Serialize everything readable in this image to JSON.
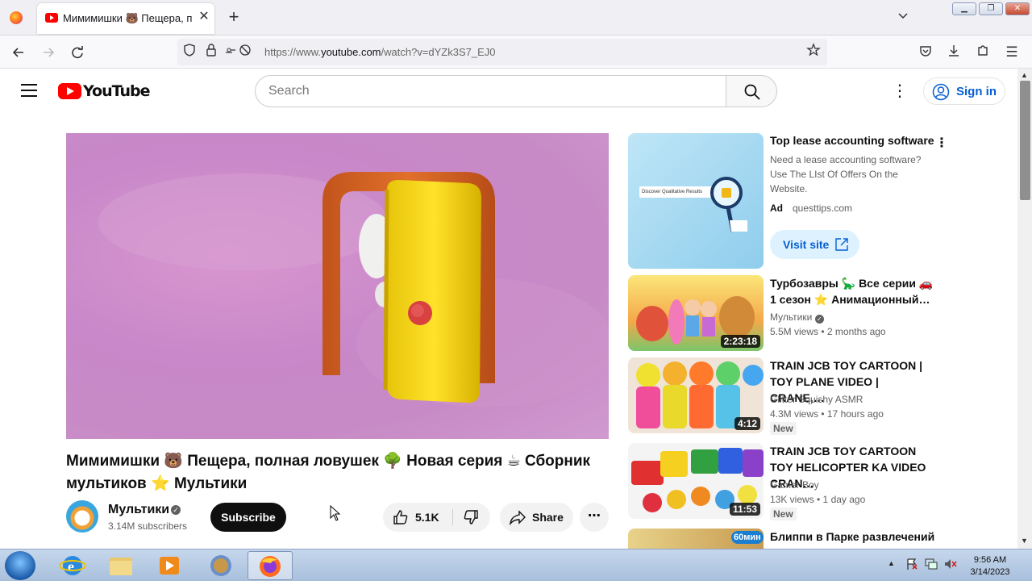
{
  "browser": {
    "tab_title": "Мимимишки 🐻 Пещера, полн",
    "url_prefix": "https://www.",
    "url_domain": "youtube.com",
    "url_path": "/watch?v=dYZk3S7_EJ0"
  },
  "header": {
    "logo_text": "YouTube",
    "search_placeholder": "Search",
    "signin_label": "Sign in"
  },
  "video": {
    "title": "Мимимишки 🐻 Пещера, полная ловушек 🌳 Новая серия ☕ Сборник мультиков ⭐ Мультики",
    "channel": "Мультики",
    "subscribers": "3.14M subscribers",
    "subscribe_label": "Subscribe",
    "likes": "5.1K",
    "share_label": "Share"
  },
  "ad": {
    "title": "Top lease accounting software",
    "description": "Need a lease accounting software? Use The LIst Of Offers On the Website.",
    "badge": "Ad",
    "domain": "questtips.com",
    "cta": "Visit site",
    "thumb_text": "Discover Qualitative Results"
  },
  "related": [
    {
      "title": "Турбозавры 🦕 Все серии 🚗 1 сезон ⭐ Анимационный…",
      "channel": "Мультики",
      "verified": true,
      "meta": "5.5M views • 2 months ago",
      "duration": "2:23:18",
      "new": false
    },
    {
      "title": "TRAIN JCB TOY CARTOON | TOY PLANE VIDEO | CRANE,…",
      "channel": "Glitter Squishy ASMR",
      "verified": false,
      "meta": "4.3M views • 17 hours ago",
      "duration": "4:12",
      "new": true
    },
    {
      "title": "TRAIN JCB TOY CARTOON TOY HELICOPTER KA VIDEO CRAN…",
      "channel": "Gamer Boy",
      "verified": false,
      "meta": "13K views • 1 day ago",
      "duration": "11:53",
      "new": true
    },
    {
      "title": "Блиппи в Парке развлечений",
      "badge_text": "60мин"
    }
  ],
  "badges": {
    "new_label": "New"
  },
  "taskbar": {
    "time": "9:56 AM",
    "date": "3/14/2023"
  },
  "colors": {
    "brand_red": "#ff0000",
    "link_blue": "#065fd4"
  }
}
